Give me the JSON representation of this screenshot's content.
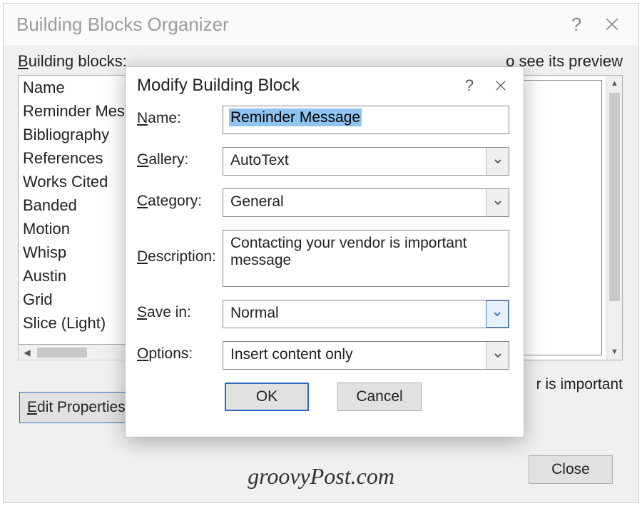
{
  "parent": {
    "title": "Building Blocks Organizer",
    "building_blocks_label": "Building blocks:",
    "preview_hint_tail": "o see its preview",
    "list_header": "Name",
    "items": [
      "Reminder Mes",
      "Bibliography",
      "References",
      "Works Cited",
      "Banded",
      "Motion",
      "Whisp",
      "Austin",
      "Grid",
      "Slice (Light)"
    ],
    "edit_properties_label": "Edit Properties.",
    "preview_caption_tail": "r is important",
    "close_label": "Close"
  },
  "modal": {
    "title": "Modify Building Block",
    "fields": {
      "name_label": "Name:",
      "name_value": "Reminder Message",
      "gallery_label": "Gallery:",
      "gallery_value": "AutoText",
      "category_label": "Category:",
      "category_value": "General",
      "description_label": "Description:",
      "description_value": "Contacting your vendor is important message",
      "savein_label": "Save in:",
      "savein_value": "Normal",
      "options_label": "Options:",
      "options_value": "Insert content only"
    },
    "ok_label": "OK",
    "cancel_label": "Cancel"
  },
  "watermark": "groovyPost.com"
}
